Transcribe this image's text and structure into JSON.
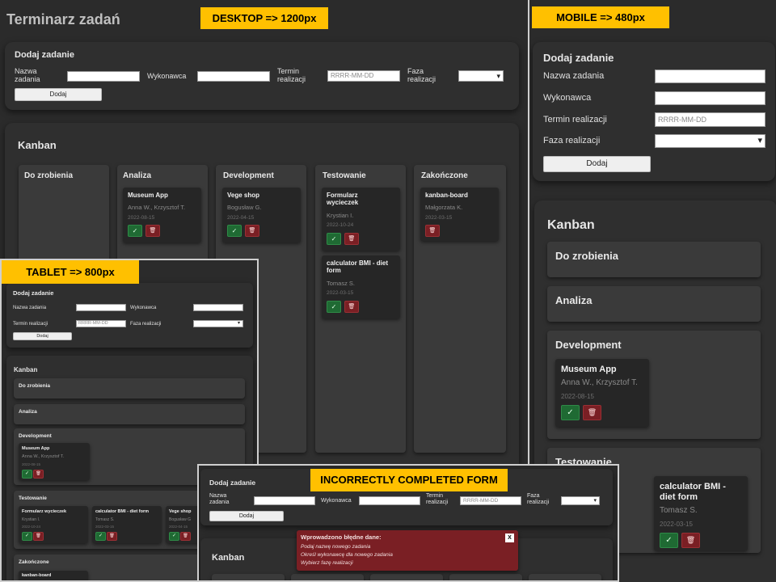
{
  "app_title": "Terminarz zadań",
  "labels": {
    "desktop": "DESKTOP => 1200px",
    "mobile": "MOBILE => 480px",
    "tablet": "TABLET => 800px",
    "incorrect": "INCORRECTLY COMPLETED FORM"
  },
  "form": {
    "heading": "Dodaj zadanie",
    "task_name_label": "Nazwa zadania",
    "assignee_label": "Wykonawca",
    "deadline_label": "Termin realizacji",
    "phase_label": "Faza realizacji",
    "date_placeholder": "RRRR-MM-DD",
    "submit_label": "Dodaj",
    "select_arrow": "▾"
  },
  "kanban": {
    "heading": "Kanban",
    "columns": [
      "Do zrobienia",
      "Analiza",
      "Development",
      "Testowanie",
      "Zakończone"
    ]
  },
  "cards": {
    "museum": {
      "title": "Museum App",
      "assignee": "Anna W., Krzysztof T.",
      "date": "2022-08-15"
    },
    "vege": {
      "title": "Vege shop",
      "assignee": "Bogusław G.",
      "assignee_short": "Bogusław G",
      "date": "2022-04-15"
    },
    "formularz": {
      "title": "Formularz wycieczek",
      "assignee": "Krystian I.",
      "date": "2022-10-24"
    },
    "bmi": {
      "title": "calculator BMI - diet form",
      "assignee": "Tomasz S.",
      "date": "2022-03-15"
    },
    "kanban_board": {
      "title": "kanban-board",
      "assignee": "Małgorzata K.",
      "date": "2022-03-15"
    }
  },
  "icons": {
    "ok": "✓",
    "delete": "🗑"
  },
  "error": {
    "title": "Wprowadzono błędne dane:",
    "lines": [
      "Podaj nazwę nowego zadania",
      "Określ wykonawcę dla nowego zadania",
      "Wybierz fazę realizacji"
    ],
    "close": "X"
  },
  "colors": {
    "label_bg": "#ffc000",
    "ok_button": "#1f6a33",
    "delete_button": "#7a1f24",
    "error_bg": "#7a1f24"
  }
}
